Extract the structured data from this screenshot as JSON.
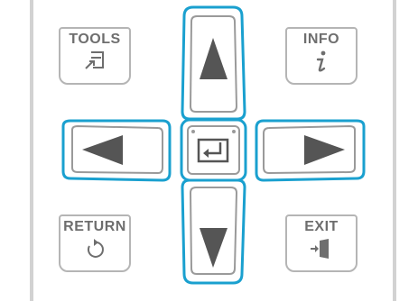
{
  "keys": {
    "tools": {
      "label": "TOOLS"
    },
    "info": {
      "label": "INFO"
    },
    "return": {
      "label": "RETURN"
    },
    "exit": {
      "label": "EXIT"
    }
  },
  "dpad": {
    "up": "up-arrow",
    "down": "down-arrow",
    "left": "left-arrow",
    "right": "right-arrow",
    "center": "enter-icon"
  },
  "colors": {
    "highlight": "#1aa0cf",
    "arrow": "#555555",
    "border": "#9a9a9a",
    "label": "#6e6e6e"
  }
}
